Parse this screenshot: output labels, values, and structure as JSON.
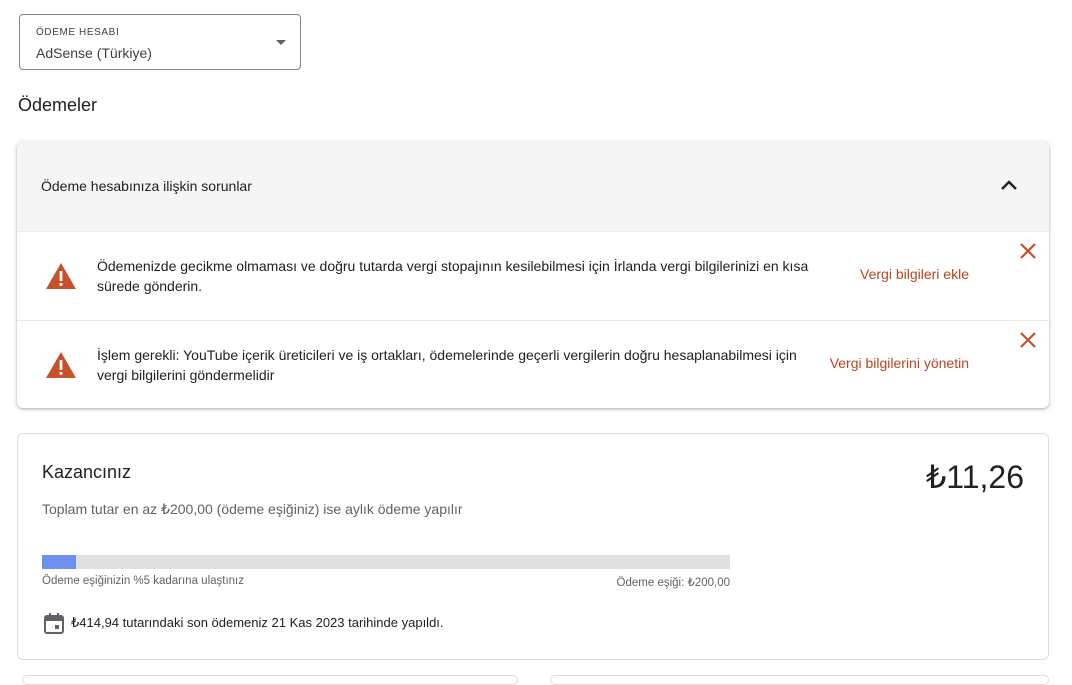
{
  "payment_account": {
    "label": "ÖDEME HESABI",
    "value": "AdSense (Türkiye)"
  },
  "section_title": "Ödemeler",
  "issues": {
    "title": "Ödeme hesabınıza ilişkin sorunlar",
    "items": [
      {
        "text": "Ödemenizde gecikme olmaması ve doğru tutarda vergi stopajının kesilebilmesi için İrlanda vergi bilgilerinizi en kısa sürede gönderin.",
        "action": "Vergi bilgileri ekle"
      },
      {
        "text": "İşlem gerekli: YouTube içerik üreticileri ve iş ortakları, ödemelerinde geçerli vergilerin doğru hesaplanabilmesi için vergi bilgilerini göndermelidir",
        "action": "Vergi bilgilerini yönetin"
      }
    ]
  },
  "earnings": {
    "title": "Kazancınız",
    "amount": "₺11,26",
    "subtitle": "Toplam tutar en az ₺200,00 (ödeme eşiğiniz) ise aylık ödeme yapılır",
    "progress_fraction": 0.05,
    "progress_left_label": "Ödeme eşiğinizin %5 kadarına ulaştınız",
    "progress_right_label": "Ödeme eşiği: ₺200,00",
    "last_payment": "₺414,94 tutarındaki son ödemeniz 21 Kas 2023 tarihinde yapıldı."
  },
  "colors": {
    "warning": "#c5522b",
    "link": "#b3471f",
    "progress": "#6d8ff0"
  }
}
